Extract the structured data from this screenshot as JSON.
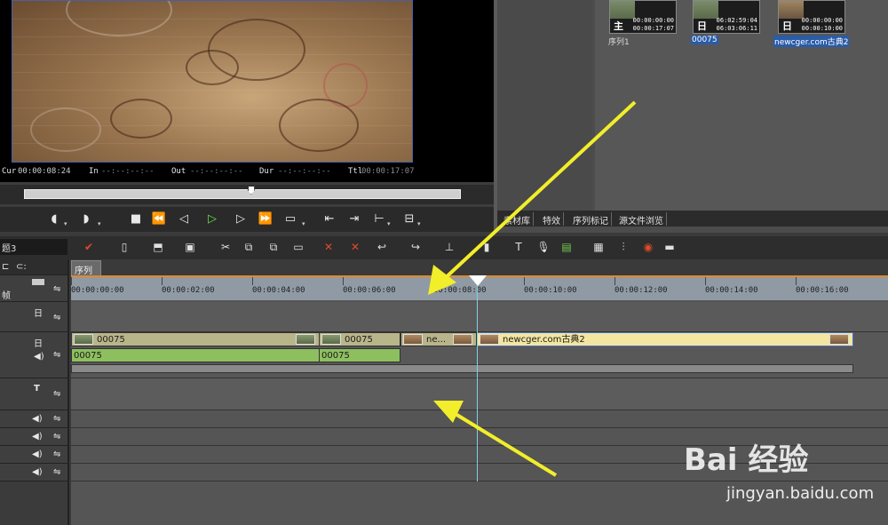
{
  "player": {
    "timecodes": {
      "cur_label": "Cur",
      "cur_value": "00:00:08:24",
      "in_label": "In",
      "in_value": "--:--:--:--",
      "out_label": "Out",
      "out_value": "--:--:--:--",
      "dur_label": "Dur",
      "dur_value": "--:--:--:--",
      "ttl_label": "Ttl",
      "ttl_value": "00:00:17:07"
    },
    "scrub_position": 0.52
  },
  "bin": {
    "clips": [
      {
        "name": "序列1",
        "badge": "主",
        "tc1": "00:00:00:00",
        "tc2": "00:00:17:07",
        "selected": false
      },
      {
        "name": "00075",
        "badge": "日",
        "tc1": "06:02:59:04",
        "tc2": "06:03:06:11",
        "selected": true
      },
      {
        "name": "newcger.com古典2",
        "badge": "日",
        "tc1": "00:00:00:00",
        "tc2": "00:00:10:00",
        "selected": true
      }
    ],
    "tabs": [
      "素材库",
      "特效",
      "序列标记",
      "源文件浏览"
    ]
  },
  "timeline": {
    "sequence_title": "题3",
    "sequence_tab": "序列1",
    "ruler_labels": [
      "00:00:00:00",
      "00:00:02:00",
      "00:00:04:00",
      "00:00:06:00",
      "00:00:08:00",
      "00:00:10:00",
      "00:00:12:00",
      "00:00:14:00",
      "00:00:16:00"
    ],
    "track_header_labels": {
      "row1": "帧"
    },
    "video_clips": [
      {
        "label": "00075"
      },
      {
        "label": "00075"
      },
      {
        "label": "ne..."
      },
      {
        "label": "newcger.com古典2"
      }
    ],
    "audio_clips": [
      {
        "label": "00075"
      },
      {
        "label": "00075"
      }
    ]
  },
  "watermark": {
    "logo": "Bai 经验",
    "url": "jingyan.baidu.com"
  },
  "colors": {
    "accent_arrow": "#f2ee2a",
    "video_clip": "#b9b58a",
    "audio_clip": "#8dbf5f",
    "selected_clip": "#f2e6a0",
    "ruler": "#909aa4",
    "play_green": "#6fe04a"
  }
}
